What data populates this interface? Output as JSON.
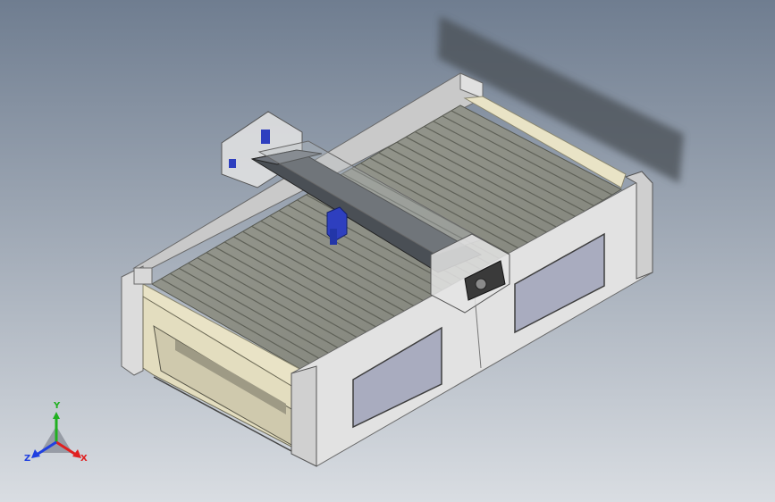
{
  "viewport": {
    "background_top": "#6f7d90",
    "background_bottom": "#d9dde2"
  },
  "model": {
    "frame_color": "#d6d6d6",
    "panel_color": "#a9acbf",
    "bed_color": "#8d8f85",
    "slat_color": "#5f6158",
    "gantry_color": "#3b3f44",
    "head_color": "#2e3fbf",
    "inner_wall_color": "#e9e3c6"
  },
  "triad": {
    "x_label": "X",
    "y_label": "Y",
    "z_label": "Z",
    "x_color": "#e02020",
    "y_color": "#20b020",
    "z_color": "#2040e0"
  }
}
